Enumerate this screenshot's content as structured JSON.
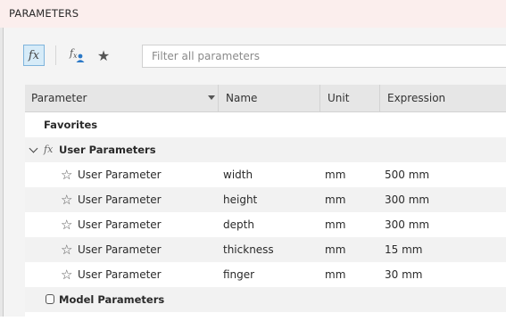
{
  "window": {
    "title": "PARAMETERS"
  },
  "toolbar": {
    "fx_icon": "fx-icon",
    "user_params_icon": "fx-user-icon",
    "favorites_icon": "star-icon",
    "filter_placeholder": "Filter all parameters"
  },
  "columns": [
    "Parameter",
    "Name",
    "Unit",
    "Expression"
  ],
  "groups": {
    "favorites": "Favorites",
    "user_parameters": "User Parameters",
    "model_parameters": "Model Parameters"
  },
  "parameters": [
    {
      "label": "User Parameter",
      "name": "width",
      "unit": "mm",
      "expression": "500 mm"
    },
    {
      "label": "User Parameter",
      "name": "height",
      "unit": "mm",
      "expression": "300 mm"
    },
    {
      "label": "User Parameter",
      "name": "depth",
      "unit": "mm",
      "expression": "300 mm"
    },
    {
      "label": "User Parameter",
      "name": "thickness",
      "unit": "mm",
      "expression": "15 mm"
    },
    {
      "label": "User Parameter",
      "name": "finger",
      "unit": "mm",
      "expression": "30 mm"
    }
  ],
  "colors": {
    "accent": "#d6ebf8",
    "titlebar": "#fbeeed"
  }
}
